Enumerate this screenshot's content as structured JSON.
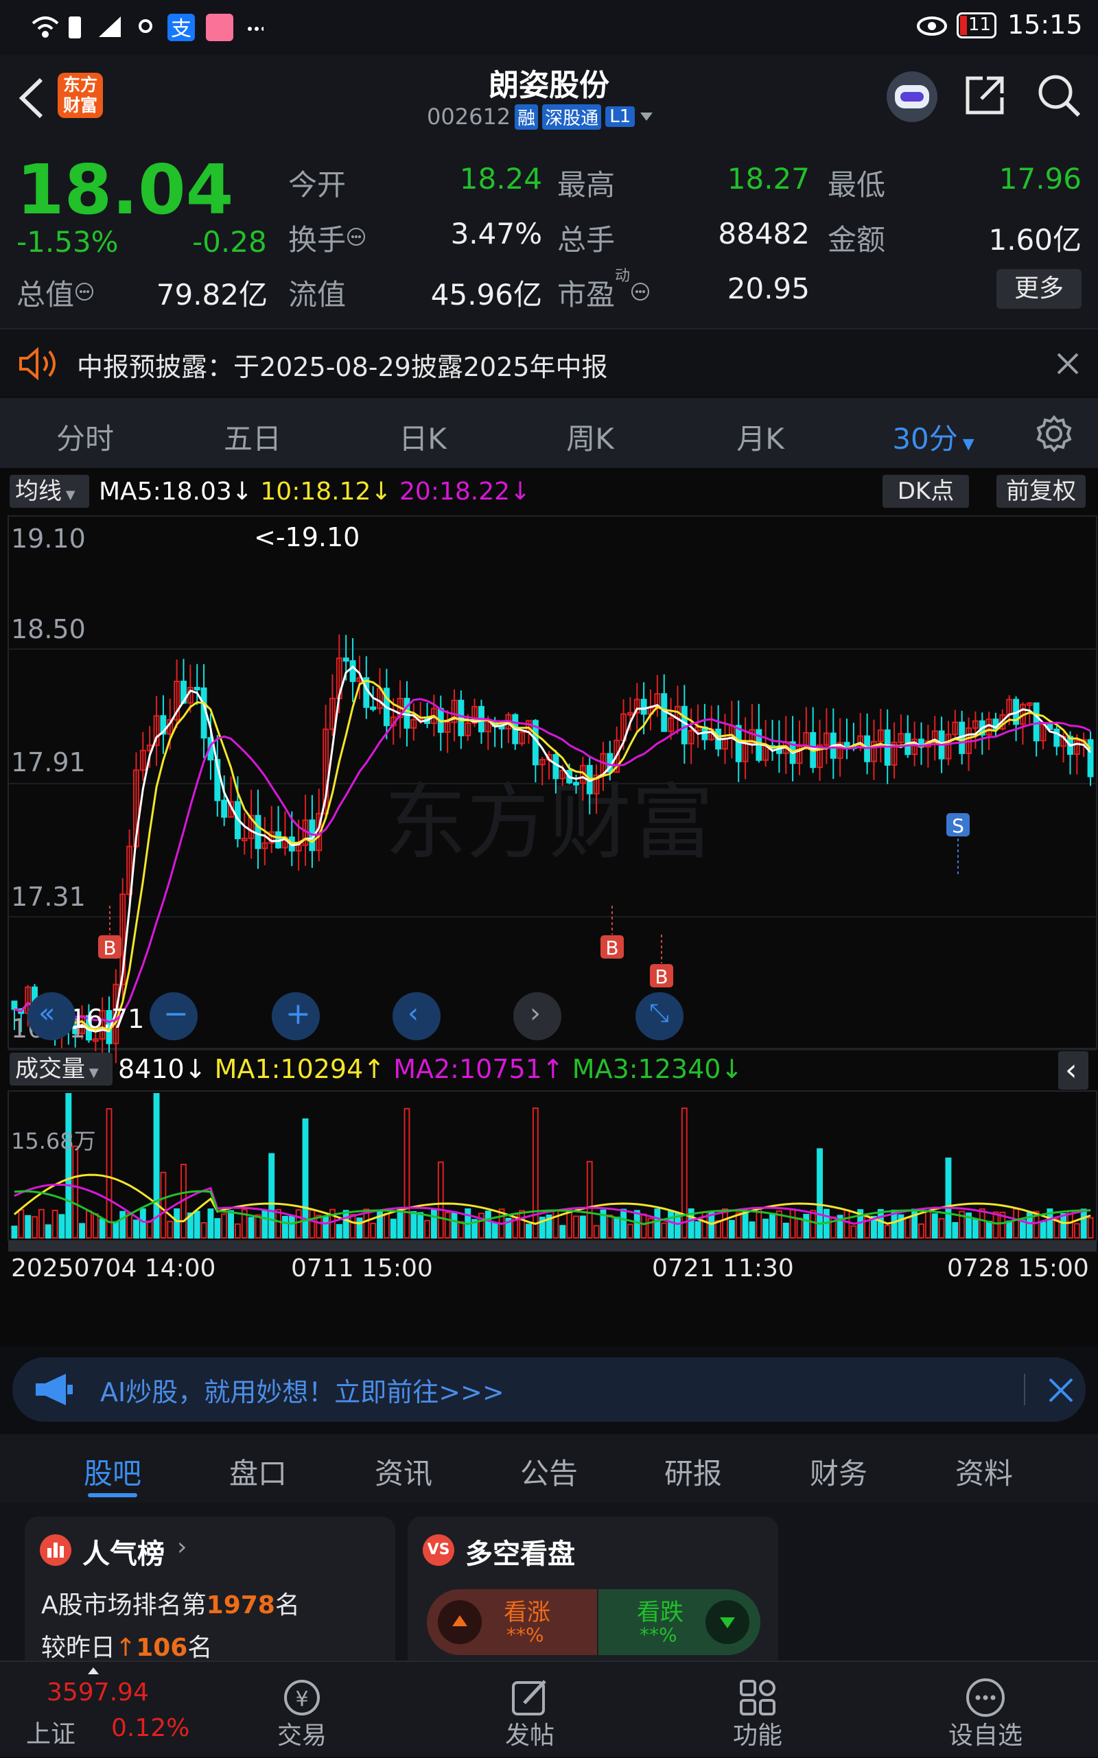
{
  "status_bar": {
    "time": "15:15",
    "battery": "11",
    "icons_left": [
      "wifi-icon",
      "battery-alert-icon",
      "signal-icon",
      "hotspot-icon",
      "alipay-icon",
      "app-icon",
      "more-dots-icon"
    ]
  },
  "header": {
    "logo_line1": "东方",
    "logo_line2": "财富",
    "stock_name": "朗姿股份",
    "stock_code": "002612",
    "badge_margin": "融",
    "badge_connect": "深股通",
    "badge_level": "L1"
  },
  "quote": {
    "price": "18.04",
    "change_pct": "-1.53%",
    "change": "-0.28",
    "open_label": "今开",
    "open": "18.24",
    "high_label": "最高",
    "high": "18.27",
    "low_label": "最低",
    "low": "17.96",
    "turnover_label": "换手",
    "turnover": "3.47%",
    "volume_label": "总手",
    "volume": "88482",
    "amount_label": "金额",
    "amount": "1.60亿",
    "mcap_label": "总值",
    "mcap": "79.82亿",
    "float_label": "流值",
    "float_cap": "45.96亿",
    "pe_label": "市盈",
    "pe_sup": "动",
    "pe": "20.95",
    "more_button": "更多"
  },
  "notice": {
    "text": "中报预披露：于2025-08-29披露2025年中报"
  },
  "chart_tabs": [
    "分时",
    "五日",
    "日K",
    "周K",
    "月K",
    "30分"
  ],
  "indicator": {
    "ma_selector": "均线",
    "ma5": "MA5:18.03",
    "ma10": "10:18.12",
    "ma20": "20:18.22",
    "dk_button": "DK点",
    "adjust_button": "前复权",
    "price_ticks": [
      "19.10",
      "18.50",
      "17.91",
      "17.31",
      "16.71"
    ],
    "max_label": "<-19.10",
    "min_label": "<-16.71",
    "vol_selector": "成交量",
    "vol_value": "8410",
    "vol_ma1": "MA1:10294",
    "vol_ma2": "MA2:10751",
    "vol_ma3": "MA3:12340",
    "vol_max": "15.68万",
    "time_labels": [
      "20250704 14:00",
      "0711 15:00",
      "0721 11:30",
      "0728 15:00"
    ],
    "signals": [
      "B",
      "B",
      "B",
      "S"
    ],
    "colors": {
      "up": "#e02020",
      "down": "#16e0e0",
      "ma5": "#ffffff",
      "ma10": "#f5e629",
      "ma20": "#d818d8",
      "vol_ma3": "#22c02a"
    }
  },
  "ai_banner": {
    "text": "AI炒股，就用妙想！立即前往>>>"
  },
  "sub_tabs": [
    "股吧",
    "盘口",
    "资讯",
    "公告",
    "研报",
    "财务",
    "资料"
  ],
  "popularity": {
    "title": "人气榜",
    "rank_prefix": "A股市场排名第",
    "rank": "1978",
    "rank_suffix": "名",
    "change_prefix": "较昨日",
    "change": "106",
    "change_suffix": "名"
  },
  "sentiment": {
    "title": "多空看盘",
    "bull_label": "看涨",
    "bull_value": "**%",
    "bear_label": "看跌",
    "bear_value": "**%"
  },
  "bottom_nav": {
    "index_value": "3597.94",
    "index_name": "上证",
    "index_change": "0.12%",
    "items": [
      "交易",
      "发帖",
      "功能",
      "设自选"
    ]
  }
}
